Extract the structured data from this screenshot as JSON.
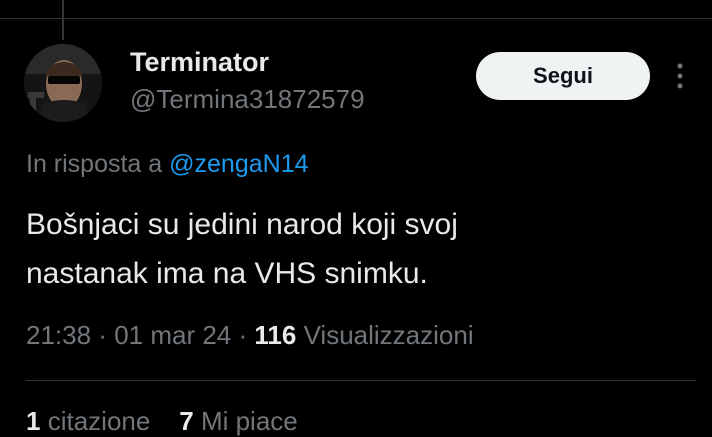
{
  "tweet": {
    "author": {
      "display_name": "Terminator",
      "handle": "@Termina31872579",
      "avatar_icon": "avatar-terminator"
    },
    "follow_label": "Segui",
    "more_icon": "more-vertical-icon",
    "reply": {
      "prefix": "In risposta a",
      "mention": "@zengaN14"
    },
    "text_line_1": "Bošnjaci su jedini narod koji svoj",
    "text_line_2": "nastanak ima na VHS snimku.",
    "meta": {
      "time": "21:38",
      "sep_1": " · ",
      "date": "01 mar 24",
      "sep_2": " · ",
      "views_count": "116",
      "views_label": "Visualizzazioni"
    },
    "stats": {
      "quotes_count": "1",
      "quotes_label": "citazione",
      "likes_count": "7",
      "likes_label": "Mi piace"
    }
  },
  "colors": {
    "background": "#000000",
    "text_primary": "#e7e9ea",
    "text_secondary": "#71767b",
    "accent": "#1d9bf0",
    "button_bg": "#eff3f4",
    "divider": "#2f3336"
  }
}
